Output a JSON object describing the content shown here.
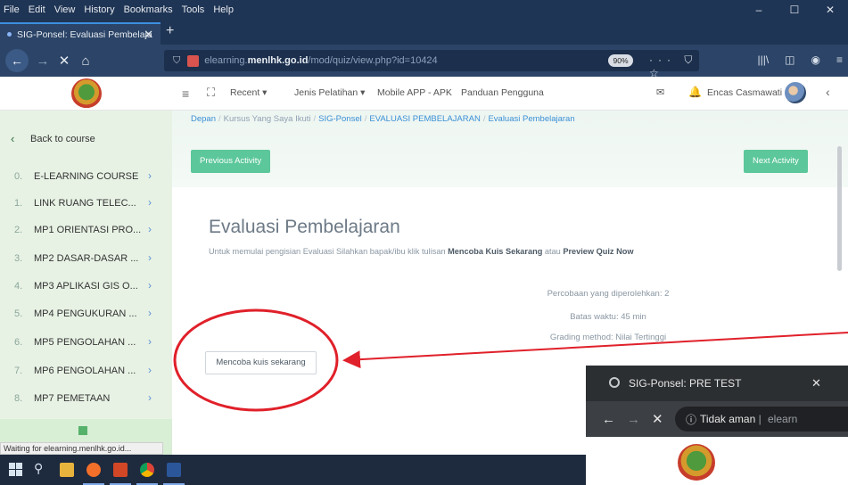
{
  "window": {
    "menu": [
      "File",
      "Edit",
      "View",
      "History",
      "Bookmarks",
      "Tools",
      "Help"
    ],
    "controls": {
      "minimize": "–",
      "maximize": "☐",
      "close": "✕"
    }
  },
  "tab": {
    "title": "SIG-Ponsel: Evaluasi Pembelaja",
    "close": "✕",
    "new": "+"
  },
  "navbar": {
    "url_prefix": "elearning.",
    "url_domain": "menlhk.go.id",
    "url_path": "/mod/quiz/view.php?id=10424",
    "zoom": "90%",
    "page_actions": "··· ⛉ ☆"
  },
  "site_nav": {
    "recent": "Recent ▾",
    "jenis": "Jenis Pelatihan ▾",
    "mobile": "Mobile APP - APK",
    "panduan": "Panduan Pengguna",
    "username": "Encas Casmawati"
  },
  "sidebar": {
    "back": "Back to course",
    "items": [
      {
        "num": "0.",
        "label": "E-LEARNING COURSE"
      },
      {
        "num": "1.",
        "label": "LINK RUANG TELEC..."
      },
      {
        "num": "2.",
        "label": "MP1 ORIENTASI PRO..."
      },
      {
        "num": "3.",
        "label": "MP2 DASAR-DASAR ..."
      },
      {
        "num": "4.",
        "label": "MP3 APLIKASI GIS O..."
      },
      {
        "num": "5.",
        "label": "MP4 PENGUKURAN ..."
      },
      {
        "num": "6.",
        "label": "MP5 PENGOLAHAN ..."
      },
      {
        "num": "7.",
        "label": "MP6 PENGOLAHAN ..."
      },
      {
        "num": "8.",
        "label": "MP7 PEMETAAN"
      }
    ]
  },
  "breadcrumb": [
    {
      "label": "Depan",
      "link": true
    },
    {
      "label": "Kursus Yang Saya Ikuti",
      "link": false
    },
    {
      "label": "SIG-Ponsel",
      "link": true
    },
    {
      "label": "EVALUASI PEMBELAJARAN",
      "link": true
    },
    {
      "label": "Evaluasi Pembelajaran",
      "link": true
    }
  ],
  "main": {
    "prev_activity": "Previous Activity",
    "next_activity": "Next Activity",
    "title": "Evaluasi Pembelajaran",
    "intro_pre": "Untuk memulai pengisian Evaluasi Silahkan bapak/ibu klik tulisan ",
    "intro_b1": "Mencoba Kuis Sekarang",
    "intro_mid": " atau ",
    "intro_b2": "Preview Quiz Now",
    "attempts": "Percobaan yang diperolehkan: 2",
    "time_limit": "Batas waktu: 45 min",
    "grading": "Grading method: Nilai Tertinggi",
    "start_button": "Mencoba kuis sekarang"
  },
  "status": "Waiting for elearning.menlhk.go.id...",
  "popup": {
    "tab_title": "SIG-Ponsel: PRE TEST",
    "close": "✕",
    "secure": "Tidak aman",
    "sep": "|",
    "url": "elearn"
  },
  "colors": {
    "accent": "#5cc79a",
    "link": "#3a8fd6",
    "annotation": "#e0202a"
  }
}
